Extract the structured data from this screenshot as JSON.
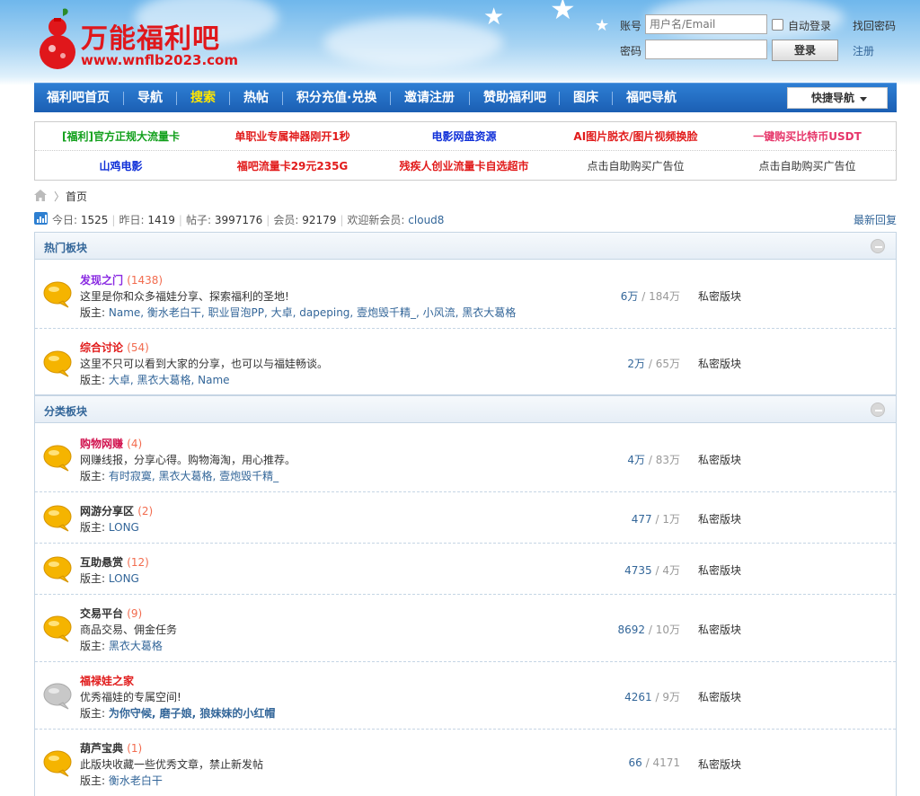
{
  "site": {
    "title": "万能福利吧",
    "url": "www.wnflb2023.com"
  },
  "login": {
    "account_label": "账号",
    "account_placeholder": "用户名/Email",
    "auto_login": "自动登录",
    "forgot": "找回密码",
    "password_label": "密码",
    "login_button": "登录",
    "register": "注册"
  },
  "nav": {
    "items": [
      "福利吧首页",
      "导航",
      "搜索",
      "热帖",
      "积分充值·兑换",
      "邀请注册",
      "赞助福利吧",
      "图床",
      "福吧导航"
    ],
    "active_index": 2,
    "quick_nav": "快捷导航"
  },
  "ads": {
    "row1": [
      {
        "text": "[福利]官方正规大流量卡",
        "color": "#12a01c"
      },
      {
        "text": "单职业专属神器刚开1秒",
        "color": "#e11b1b"
      },
      {
        "text": "电影网盘资源",
        "color": "#1030d8"
      },
      {
        "text": "AI图片脱衣/图片视频换脸",
        "color": "#e11b1b"
      },
      {
        "text": "一键购买比特币USDT",
        "color": "#e6366a"
      }
    ],
    "row2": [
      {
        "text": "山鸡电影",
        "color": "#1030d8"
      },
      {
        "text": "福吧流量卡29元235G",
        "color": "#e11b1b"
      },
      {
        "text": "残疾人创业流量卡自选超市",
        "color": "#e11b1b"
      },
      {
        "text": "点击自助购买广告位",
        "color": "#333333"
      },
      {
        "text": "点击自助购买广告位",
        "color": "#333333"
      }
    ]
  },
  "breadcrumb": {
    "current": "首页"
  },
  "stats": {
    "today_label": "今日:",
    "today": "1525",
    "yesterday_label": "昨日:",
    "yesterday": "1419",
    "posts_label": "帖子:",
    "posts": "3997176",
    "members_label": "会员:",
    "members": "92179",
    "welcome_label": "欢迎新会员:",
    "newest": "cloud8",
    "latest_reply": "最新回复"
  },
  "hot": {
    "title": "热门板块",
    "boards": [
      {
        "name": "发现之门",
        "name_color": "#8a2be2",
        "count": "(1438)",
        "desc": "这里是你和众多福娃分享、探索福利的圣地!",
        "mod_label": "版主:",
        "mods": "Name, 衡水老白干, 职业冒泡PP, 大卓, dapeping, 壹炮毁千精_, 小风流, 黑衣大葛格",
        "threads": "6万",
        "posts": "184万",
        "private": "私密版块"
      },
      {
        "name": "综合讨论",
        "name_color": "#e11b1b",
        "count": "(54)",
        "desc": "这里不只可以看到大家的分享，也可以与福娃畅谈。",
        "mod_label": "版主:",
        "mods": "大卓, 黑衣大葛格, Name",
        "threads": "2万",
        "posts": "65万",
        "private": "私密版块"
      }
    ]
  },
  "cat": {
    "title": "分类板块",
    "boards": [
      {
        "name": "购物网赚",
        "name_color": "#d1134f",
        "count": "(4)",
        "desc": "网赚线报，分享心得。购物海淘，用心推荐。",
        "mod_label": "版主:",
        "mods": "有时寂寞, 黑衣大葛格, 壹炮毁千精_",
        "threads": "4万",
        "posts": "83万",
        "private": "私密版块"
      },
      {
        "name": "网游分享区",
        "name_color": "#333333",
        "count": "(2)",
        "desc": "",
        "mod_label": "版主:",
        "mods": "LONG",
        "threads": "477",
        "posts": "1万",
        "private": "私密版块"
      },
      {
        "name": "互助悬赏",
        "name_color": "#333333",
        "count": "(12)",
        "desc": "",
        "mod_label": "版主:",
        "mods": "LONG",
        "threads": "4735",
        "posts": "4万",
        "private": "私密版块"
      },
      {
        "name": "交易平台",
        "name_color": "#333333",
        "count": "(9)",
        "desc": "商品交易、佣金任务",
        "mod_label": "版主:",
        "mods": "黑衣大葛格",
        "threads": "8692",
        "posts": "10万",
        "private": "私密版块"
      },
      {
        "name": "福禄娃之家",
        "name_color": "#e11b1b",
        "count": "",
        "desc": "优秀福娃的专属空间!",
        "mod_label": "版主:",
        "mods": "为你守候, 磨子娘, 狼妹妹的小红帽",
        "threads": "4261",
        "posts": "9万",
        "private": "私密版块"
      },
      {
        "name": "葫芦宝典",
        "name_color": "#333333",
        "count": "(1)",
        "desc": "此版块收藏一些优秀文章，禁止新发帖",
        "mod_label": "版主:",
        "mods": "衡水老白干",
        "threads": "66",
        "posts": "4171",
        "private": "私密版块"
      }
    ]
  }
}
